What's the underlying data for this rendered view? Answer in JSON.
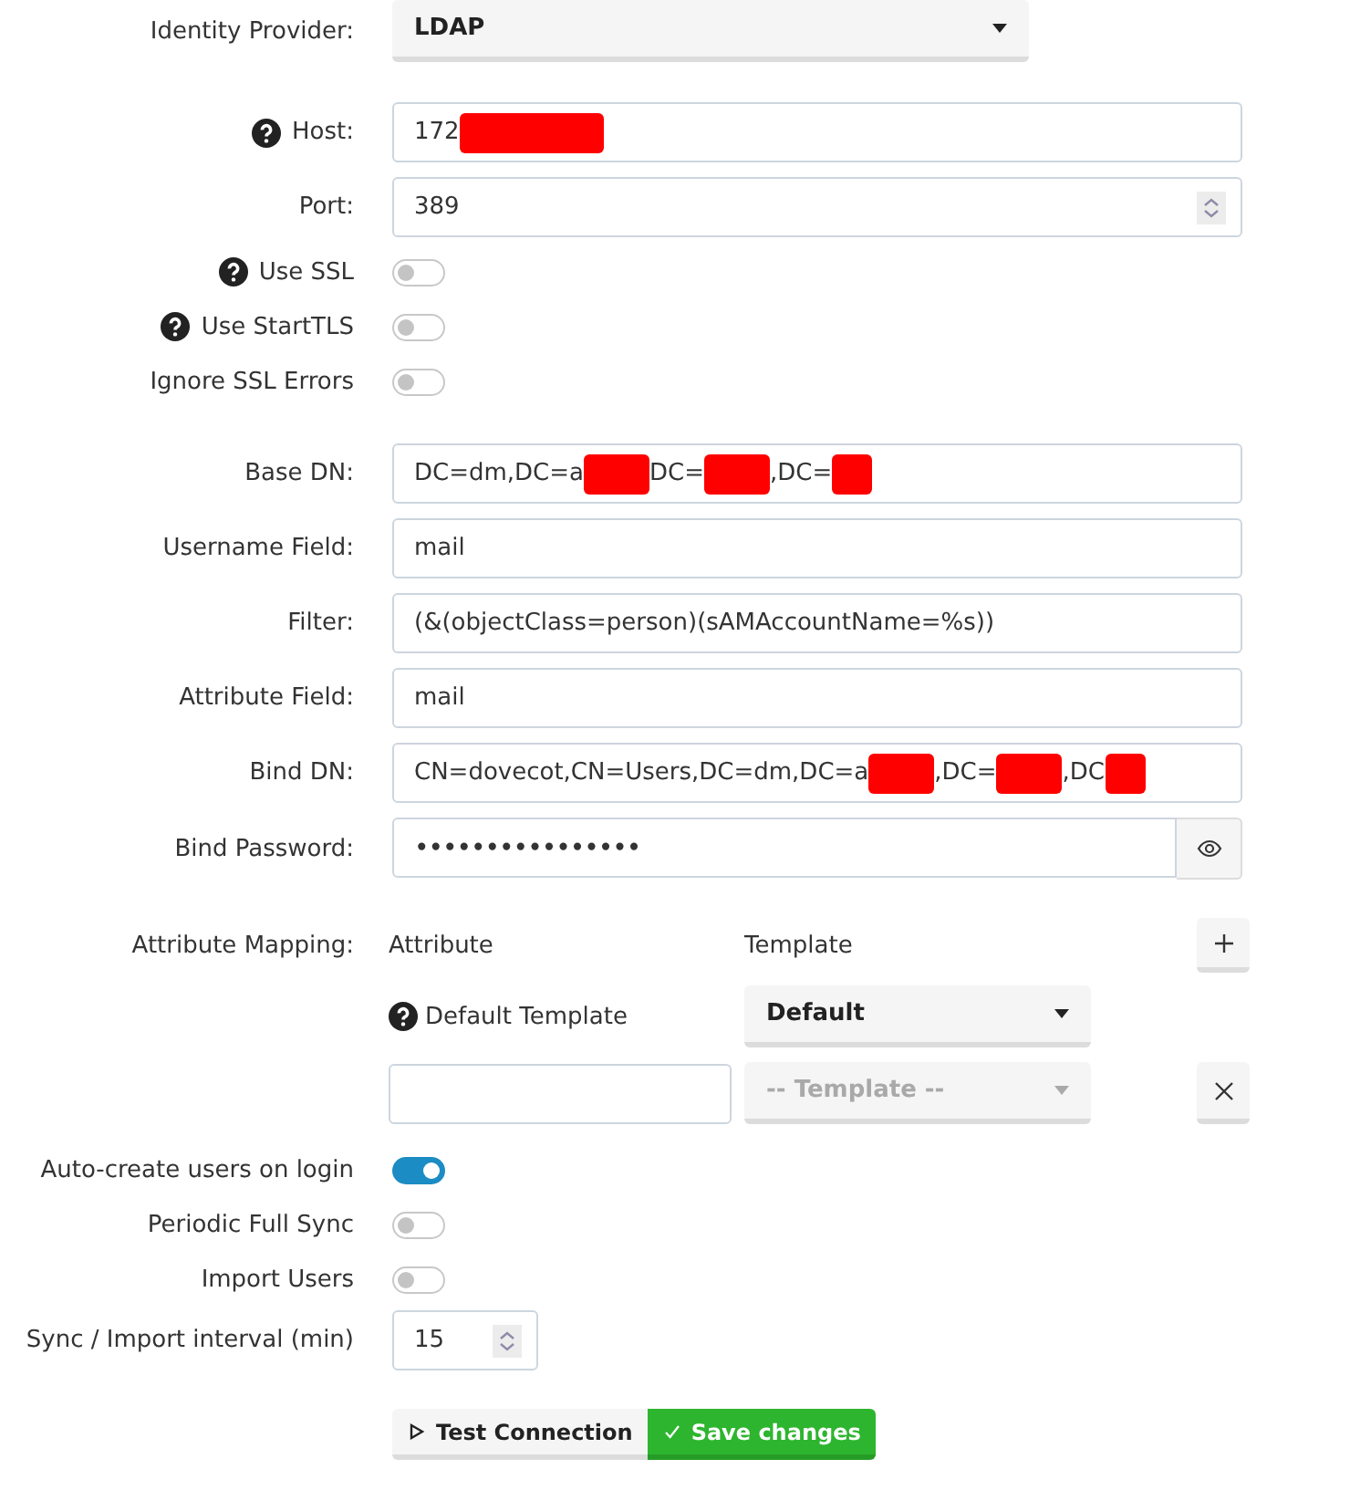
{
  "identity_provider": {
    "label": "Identity Provider:",
    "value": "LDAP"
  },
  "connection": [
    {
      "kind": "text",
      "label": "Host:",
      "help": true,
      "value_parts": [
        {
          "kind": "text",
          "text": "172"
        },
        {
          "kind": "long_redaction"
        }
      ]
    },
    {
      "kind": "number",
      "label": "Port:",
      "help": false,
      "value": "389"
    },
    {
      "kind": "toggle",
      "label": "Use SSL",
      "help": true,
      "on": false
    },
    {
      "kind": "toggle",
      "label": "Use StartTLS",
      "help": true,
      "on": false
    },
    {
      "kind": "toggle",
      "label": "Ignore SSL Errors",
      "help": false,
      "on": false
    }
  ],
  "directory": [
    {
      "kind": "text",
      "label": "Base DN:",
      "help": false,
      "value_parts": [
        {
          "kind": "text",
          "text": "DC=dm,DC=a"
        },
        {
          "kind": "redaction"
        },
        {
          "kind": "text",
          "text": "DC="
        },
        {
          "kind": "redaction"
        },
        {
          "kind": "text",
          "text": ",DC="
        },
        {
          "kind": "short_redaction"
        }
      ]
    },
    {
      "kind": "text",
      "label": "Username Field:",
      "help": false,
      "value": "mail"
    },
    {
      "kind": "text",
      "label": "Filter:",
      "help": false,
      "value": "(&(objectClass=person)(sAMAccountName=%s))"
    },
    {
      "kind": "text",
      "label": "Attribute Field:",
      "help": false,
      "value": "mail"
    },
    {
      "kind": "text",
      "label": "Bind DN:",
      "help": false,
      "value_parts": [
        {
          "kind": "text",
          "text": "CN=dovecot,CN=Users,DC=dm,DC=a"
        },
        {
          "kind": "redaction"
        },
        {
          "kind": "text",
          "text": ",DC="
        },
        {
          "kind": "redaction"
        },
        {
          "kind": "text",
          "text": ",DC"
        },
        {
          "kind": "short_redaction"
        }
      ]
    },
    {
      "kind": "password",
      "label": "Bind Password:",
      "help": false,
      "value": "••••••••••••••••"
    }
  ],
  "attribute_mapping": {
    "label": "Attribute Mapping:",
    "columns": [
      "Attribute",
      "Template"
    ],
    "rows": [
      {
        "kind": "default",
        "attribute": "Default Template",
        "help": true,
        "template": "Default",
        "disabled": false
      },
      {
        "kind": "custom",
        "template_placeholder": "-- Template --",
        "disabled": true
      }
    ]
  },
  "sync": [
    {
      "kind": "toggle",
      "label": "Auto-create users on login",
      "help": false,
      "on": true
    },
    {
      "kind": "toggle",
      "label": "Periodic Full Sync",
      "help": false,
      "on": false
    },
    {
      "kind": "toggle",
      "label": "Import Users",
      "help": false,
      "on": false
    },
    {
      "kind": "number",
      "label": "Sync / Import interval (min)",
      "help": false,
      "value": "15"
    }
  ],
  "actions": [
    {
      "kind": "test",
      "label": "Test Connection"
    },
    {
      "kind": "save",
      "label": "Save changes"
    }
  ]
}
